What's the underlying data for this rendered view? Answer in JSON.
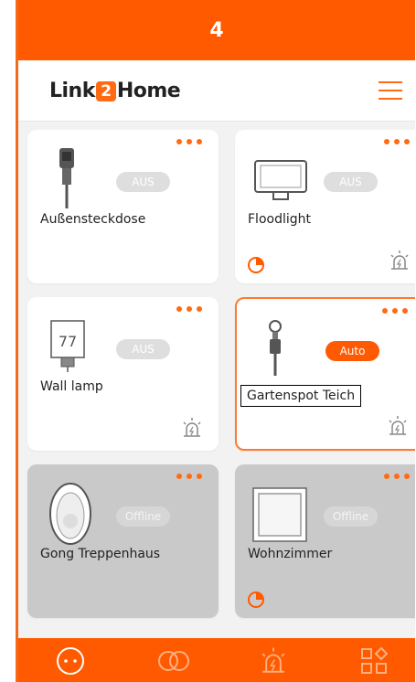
{
  "status": {
    "number": "4"
  },
  "header": {
    "logo_left": "Link",
    "logo_mid": "2",
    "logo_right": "Home"
  },
  "devices": [
    {
      "name": "Außensteckdose",
      "state": "AUS",
      "icon": "garden-socket-icon"
    },
    {
      "name": "Floodlight",
      "state": "AUS",
      "icon": "floodlight-icon"
    },
    {
      "name": "Wall lamp",
      "state": "AUS",
      "icon": "wall-lamp-icon",
      "lamp_label": "77"
    },
    {
      "name": "Gartenspot Teich",
      "state": "Auto",
      "icon": "garden-spot-icon"
    },
    {
      "name": "Gong Treppenhaus",
      "state": "Offline",
      "icon": "gong-icon"
    },
    {
      "name": "Wohnzimmer",
      "state": "Offline",
      "icon": "wall-switch-icon"
    }
  ],
  "colors": {
    "accent": "#ff5a00",
    "pill_off": "#dedede",
    "offline_card": "#c9c9c9"
  }
}
